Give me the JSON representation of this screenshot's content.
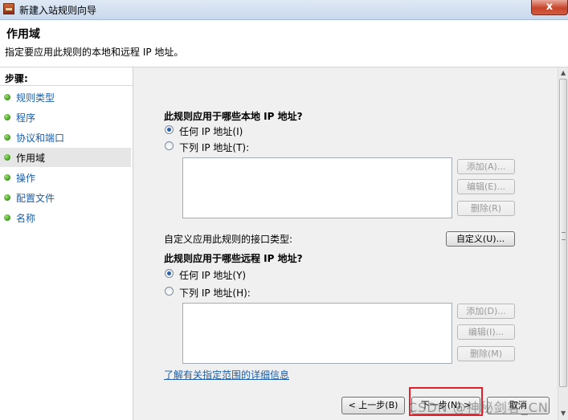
{
  "window": {
    "title": "新建入站规则向导",
    "close_label": "x"
  },
  "header": {
    "title": "作用域",
    "description": "指定要应用此规则的本地和远程 IP 地址。"
  },
  "sidebar": {
    "steps_title": "步骤:",
    "items": [
      {
        "label": "规则类型"
      },
      {
        "label": "程序"
      },
      {
        "label": "协议和端口"
      },
      {
        "label": "作用域",
        "active": true
      },
      {
        "label": "操作"
      },
      {
        "label": "配置文件"
      },
      {
        "label": "名称"
      }
    ]
  },
  "local": {
    "heading": "此规则应用于哪些本地 IP 地址?",
    "option_any": "任何 IP 地址(I)",
    "option_list": "下列 IP 地址(T):",
    "selected": "any",
    "add": "添加(A)...",
    "edit": "编辑(E)...",
    "remove": "删除(R)"
  },
  "interface": {
    "label": "自定义应用此规则的接口类型:",
    "button": "自定义(U)..."
  },
  "remote": {
    "heading": "此规则应用于哪些远程 IP 地址?",
    "option_any": "任何 IP 地址(Y)",
    "option_list": "下列 IP 地址(H):",
    "selected": "any",
    "add": "添加(D)...",
    "edit": "编辑(I)...",
    "remove": "删除(M)"
  },
  "learn_more": "了解有关指定范围的详细信息",
  "footer": {
    "back": "< 上一步(B)",
    "next": "下一步(N) >",
    "cancel": "取消"
  },
  "watermark": "CSDN @神秘剑客_CN"
}
